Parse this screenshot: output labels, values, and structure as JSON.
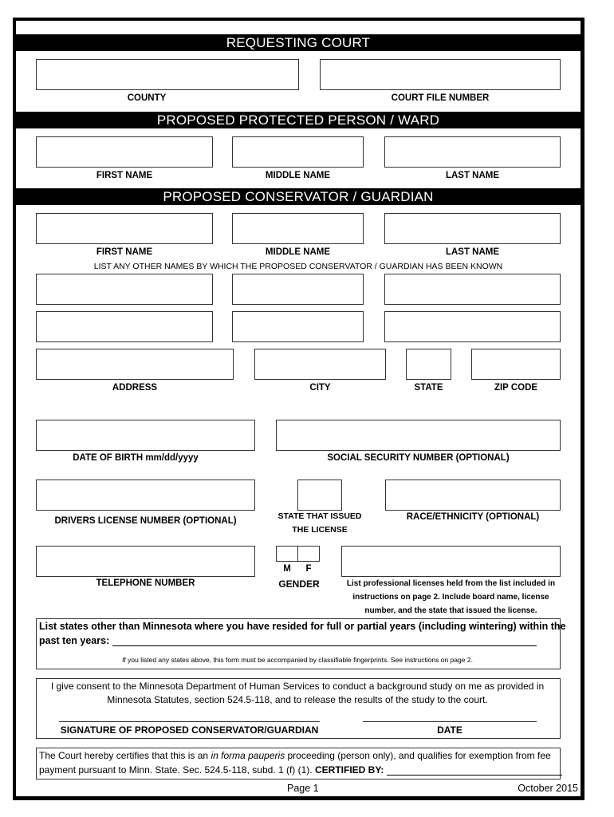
{
  "sections": {
    "requesting_court": "REQUESTING COURT",
    "protected_person": "PROPOSED PROTECTED PERSON / WARD",
    "conservator": "PROPOSED CONSERVATOR / GUARDIAN"
  },
  "labels": {
    "county": "COUNTY",
    "court_file_number": "COURT FILE NUMBER",
    "first_name": "FIRST NAME",
    "middle_name": "MIDDLE NAME",
    "last_name": "LAST NAME",
    "other_names_instruction": "LIST ANY OTHER NAMES BY WHICH THE PROPOSED CONSERVATOR / GUARDIAN HAS BEEN KNOWN",
    "address": "ADDRESS",
    "city": "CITY",
    "state": "STATE",
    "zip_code": "ZIP CODE",
    "date_of_birth": "DATE OF BIRTH mm/dd/yyyy",
    "ssn": "SOCIAL SECURITY NUMBER (OPTIONAL)",
    "drivers_license": "DRIVERS LICENSE NUMBER (OPTIONAL)",
    "state_issued_line1": "STATE THAT ISSUED",
    "state_issued_line2": "THE LICENSE",
    "race": "RACE/ETHNICITY (OPTIONAL)",
    "telephone": "TELEPHONE NUMBER",
    "gender_m": "M",
    "gender_f": "F",
    "gender": "GENDER",
    "licenses_line1": "List professional licenses held from the list included in",
    "licenses_line2": "instructions on page 2. Include board name, license",
    "licenses_line3": "number, and the state that issued the license."
  },
  "residency": {
    "line1": "List states other than Minnesota where you have resided for full or partial years (including wintering) within the",
    "line2": "past ten years:",
    "note": "If you listed any states above, this form must be accompanied by classifiable fingerprints. See instructions on page 2."
  },
  "consent": {
    "line1": "I give consent to the Minnesota Department of Human Services to conduct a background study on me as  provided in",
    "line2": "Minnesota Statutes, section 524.5-118, and to release the results of the study to the court.",
    "signature_label": "SIGNATURE OF PROPOSED CONSERVATOR/GUARDIAN",
    "date_label": "DATE"
  },
  "court_cert": {
    "pre": "The Court hereby certifies that this is an ",
    "italic": "in forma pauperis",
    "post": "  proceeding (person only), and qualifies for exemption from fee",
    "line2": "payment pursuant to Minn. State. Sec. 524.5-118, subd. 1 (f) (1).",
    "certified_by": "CERTIFIED BY:"
  },
  "footer": {
    "page": "Page 1",
    "date": "October 2015"
  }
}
